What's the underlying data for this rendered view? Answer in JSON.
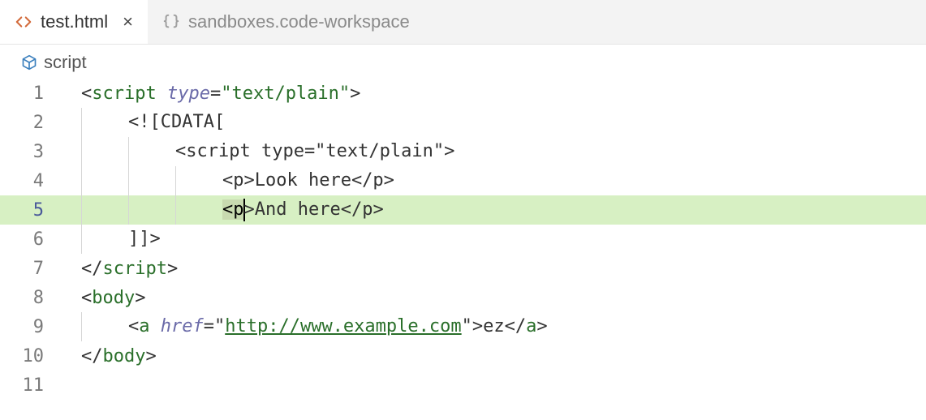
{
  "tabs": [
    {
      "label": "test.html",
      "active": true,
      "icon": "angle-brackets"
    },
    {
      "label": "sandboxes.code-workspace",
      "active": false,
      "icon": "curly-braces"
    }
  ],
  "breadcrumb": {
    "icon": "cube",
    "label": "script"
  },
  "active_line": 5,
  "code_lines": [
    {
      "n": 1,
      "indent": 0,
      "tokens": [
        {
          "t": "pun",
          "v": "<"
        },
        {
          "t": "tag",
          "v": "script"
        },
        {
          "t": "txt",
          "v": " "
        },
        {
          "t": "attr",
          "v": "type"
        },
        {
          "t": "pun",
          "v": "="
        },
        {
          "t": "str",
          "v": "\"text/plain\""
        },
        {
          "t": "pun",
          "v": ">"
        }
      ]
    },
    {
      "n": 2,
      "indent": 1,
      "tokens": [
        {
          "t": "txt",
          "v": "<![CDATA["
        }
      ]
    },
    {
      "n": 3,
      "indent": 2,
      "tokens": [
        {
          "t": "txt",
          "v": "<script type=\"text/plain\">"
        }
      ]
    },
    {
      "n": 4,
      "indent": 3,
      "tokens": [
        {
          "t": "txt",
          "v": "<p>Look here</p>"
        }
      ]
    },
    {
      "n": 5,
      "indent": 3,
      "highlight": true,
      "tokens": [
        {
          "t": "sel",
          "v": "<p"
        },
        {
          "t": "cursor",
          "v": ""
        },
        {
          "t": "txt",
          "v": ">And here</p>"
        }
      ]
    },
    {
      "n": 6,
      "indent": 1,
      "tokens": [
        {
          "t": "txt",
          "v": "]]>"
        }
      ]
    },
    {
      "n": 7,
      "indent": 0,
      "tokens": [
        {
          "t": "pun",
          "v": "</"
        },
        {
          "t": "tag",
          "v": "script"
        },
        {
          "t": "pun",
          "v": ">"
        }
      ]
    },
    {
      "n": 8,
      "indent": 0,
      "tokens": [
        {
          "t": "pun",
          "v": "<"
        },
        {
          "t": "tag",
          "v": "body"
        },
        {
          "t": "pun",
          "v": ">"
        }
      ]
    },
    {
      "n": 9,
      "indent": 1,
      "tokens": [
        {
          "t": "pun",
          "v": "<"
        },
        {
          "t": "tag",
          "v": "a"
        },
        {
          "t": "txt",
          "v": " "
        },
        {
          "t": "attr",
          "v": "href"
        },
        {
          "t": "pun",
          "v": "="
        },
        {
          "t": "pun",
          "v": "\""
        },
        {
          "t": "lnk",
          "v": "http://www.example.com"
        },
        {
          "t": "pun",
          "v": "\""
        },
        {
          "t": "pun",
          "v": ">"
        },
        {
          "t": "txt",
          "v": "ez"
        },
        {
          "t": "pun",
          "v": "</"
        },
        {
          "t": "tag",
          "v": "a"
        },
        {
          "t": "pun",
          "v": ">"
        }
      ]
    },
    {
      "n": 10,
      "indent": 0,
      "tokens": [
        {
          "t": "pun",
          "v": "</"
        },
        {
          "t": "tag",
          "v": "body"
        },
        {
          "t": "pun",
          "v": ">"
        }
      ]
    },
    {
      "n": 11,
      "indent": 0,
      "tokens": []
    }
  ],
  "close_glyph": "×"
}
